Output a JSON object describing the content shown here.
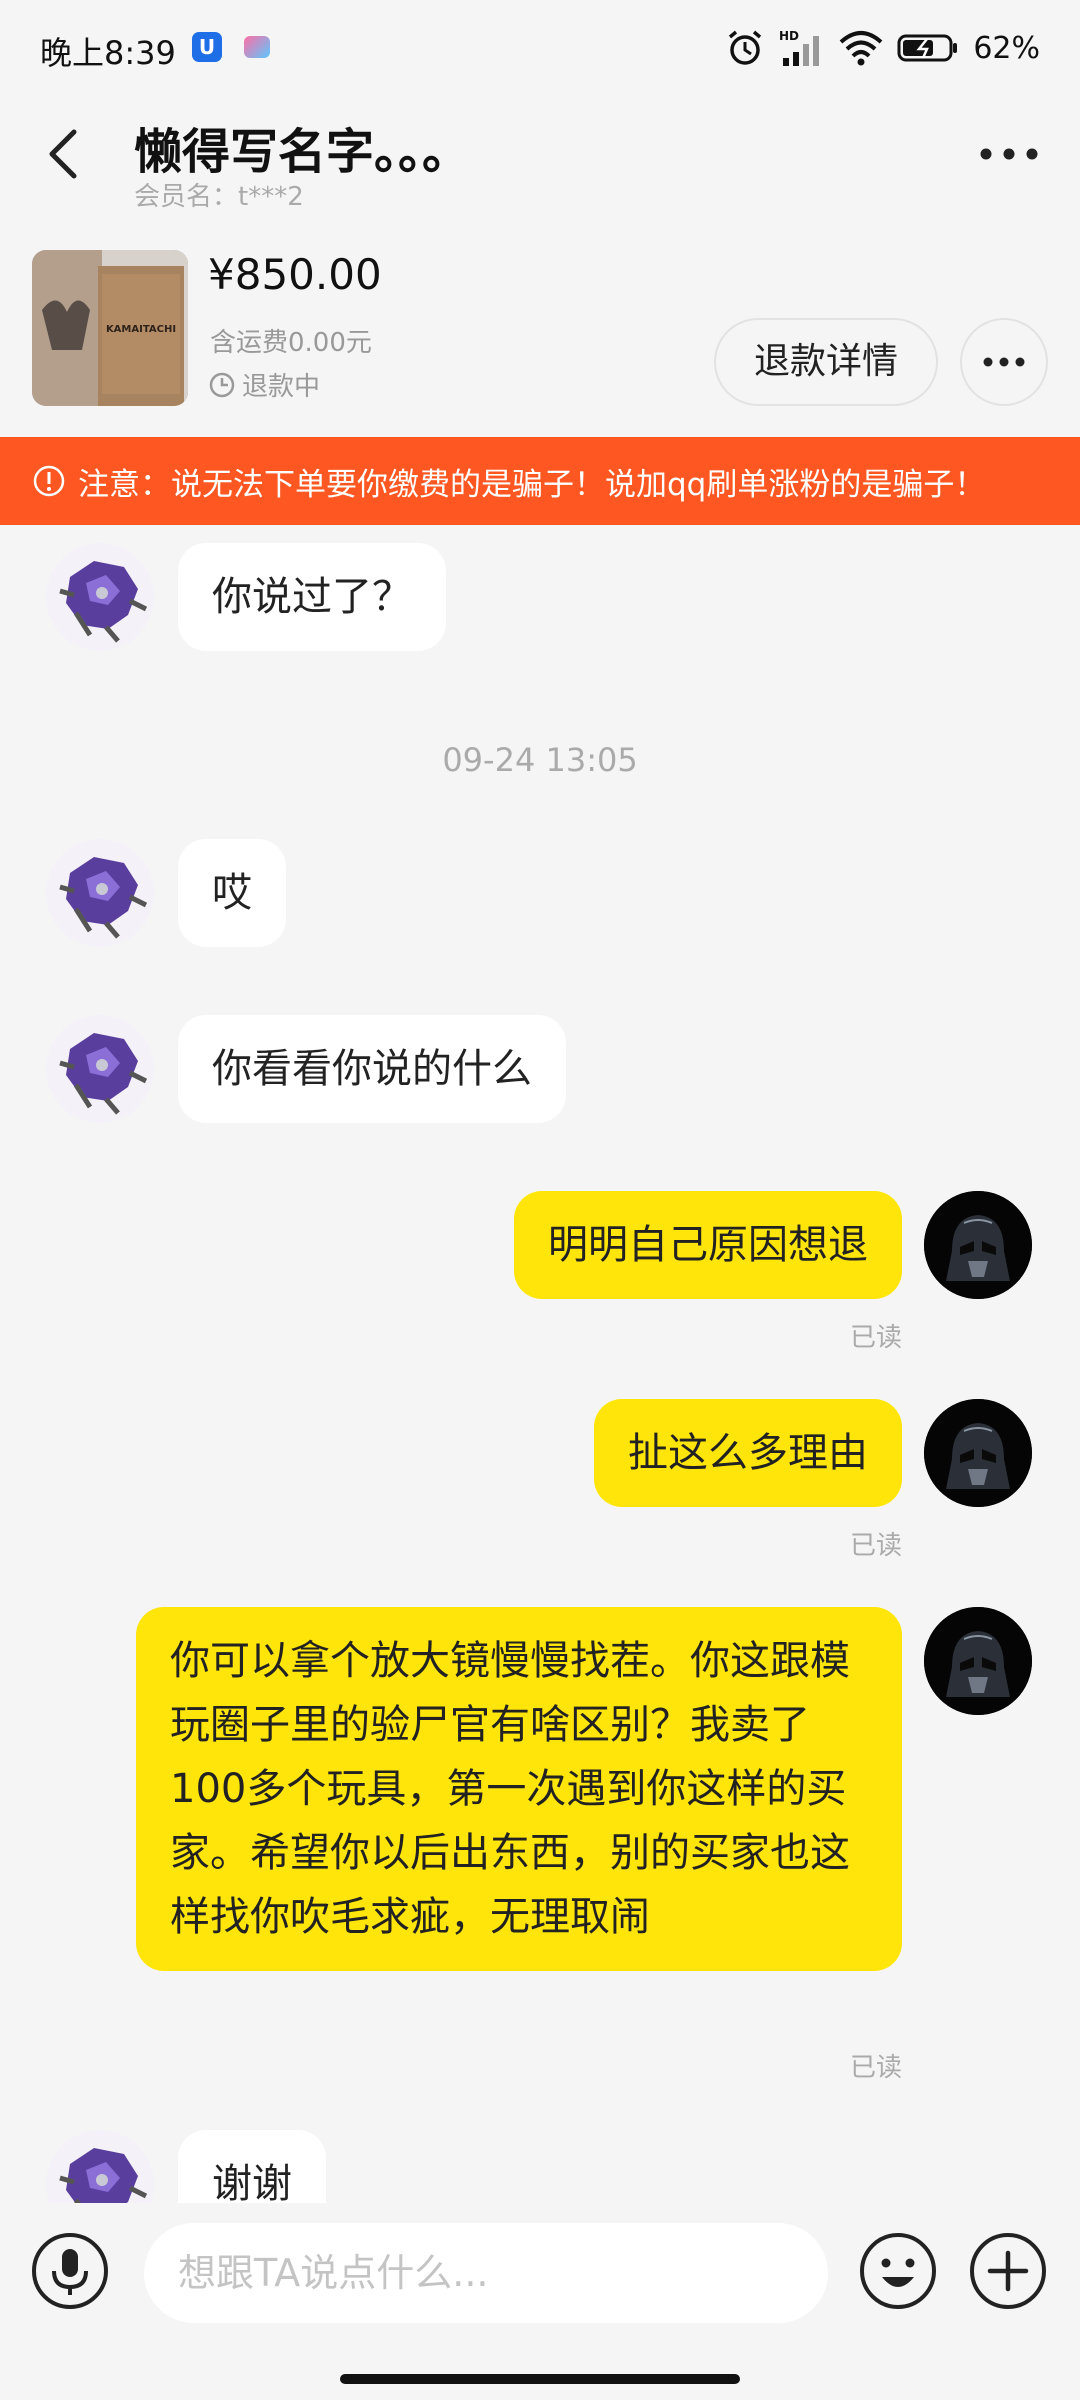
{
  "status_bar": {
    "time": "晚上8:39",
    "network_label": "HD",
    "battery": "62%"
  },
  "header": {
    "title": "懒得写名字。。。",
    "member_name": "会员名：t***2"
  },
  "product": {
    "price": "¥850.00",
    "shipping": "含运费0.00元",
    "status": "退款中",
    "box_text": "KAMAITACHI",
    "refund_button": "退款详情"
  },
  "warning": {
    "text": "注意：说无法下单要你缴费的是骗子！说加qq刷单涨粉的是骗子！"
  },
  "messages": [
    {
      "side": "in",
      "text": "你说过了？"
    },
    {
      "type": "time",
      "text": "09-24 13:05"
    },
    {
      "side": "in",
      "text": "哎"
    },
    {
      "side": "in",
      "text": "你看看你说的什么"
    },
    {
      "side": "out",
      "text": "明明自己原因想退",
      "status": "已读"
    },
    {
      "side": "out",
      "text": "扯这么多理由",
      "status": "已读"
    },
    {
      "side": "out",
      "text": "你可以拿个放大镜慢慢找茬。你这跟模玩圈子里的验尸官有啥区别？我卖了100多个玩具，第一次遇到你这样的买家。希望你以后出东西，别的买家也这样找你吹毛求疵，无理取闹",
      "status": "已读"
    },
    {
      "side": "in",
      "text": "谢谢"
    }
  ],
  "input": {
    "placeholder": "想跟TA说点什么..."
  },
  "colors": {
    "accent_yellow": "#ffe50a",
    "warning_orange": "#ff5722",
    "background": "#f5f5f5"
  },
  "icons": {
    "back": "chevron-left-icon",
    "more": "more-dots-icon",
    "clock": "clock-icon",
    "warning": "alert-circle-icon",
    "voice": "microphone-icon",
    "emoji": "emoji-icon",
    "add": "plus-icon"
  }
}
